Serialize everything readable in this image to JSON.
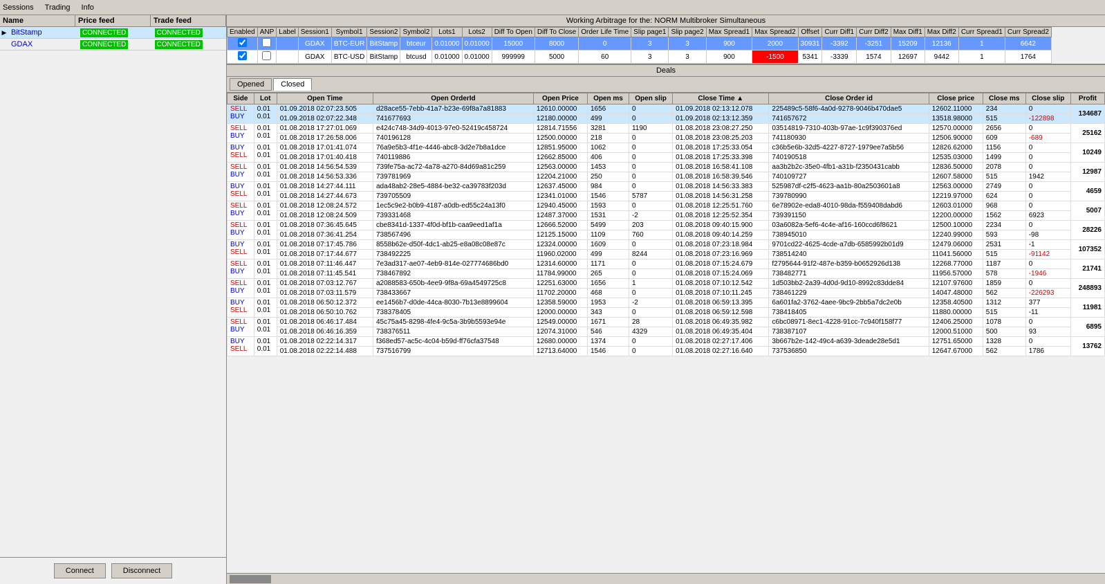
{
  "nav": {
    "items": [
      "Sessions",
      "Trading",
      "Info"
    ]
  },
  "title_bar": "Working Arbitrage for the: NORM Multibroker Simultaneous",
  "left_panel": {
    "headers": [
      "Name",
      "Price feed",
      "Trade feed"
    ],
    "rows": [
      {
        "name": "BitStamp",
        "price": "CONNECTED",
        "trade": "CONNECTED",
        "active": true
      },
      {
        "name": "GDAX",
        "price": "CONNECTED",
        "trade": "CONNECTED",
        "active": false
      }
    ]
  },
  "buttons": {
    "connect": "Connect",
    "disconnect": "Disconnect"
  },
  "top_grid": {
    "headers": [
      "Enabled",
      "ANP",
      "Label",
      "Session1",
      "Symbol1",
      "Session2",
      "Symbol2",
      "Lots1",
      "Lots2",
      "Diff To Open",
      "Diff To Close",
      "Order Life Time",
      "Slip page1",
      "Slip page2",
      "Max Spread1",
      "Max Spread2",
      "Offset",
      "Curr Diff1",
      "Curr Diff2",
      "Max Diff1",
      "Max Diff2",
      "Curr Spread1",
      "Curr Spread2"
    ],
    "rows": [
      {
        "enabled": true,
        "anp": false,
        "label": "",
        "session1": "GDAX",
        "symbol1": "BTC-EUR",
        "session2": "BitStamp",
        "symbol2": "btceur",
        "lots1": "0.01000",
        "lots2": "0.01000",
        "diff_open": "15000",
        "diff_close": "8000",
        "order_life": "0",
        "slip1": "3",
        "slip2": "3",
        "max_spread1": "900",
        "max_spread2": "2000",
        "offset": "30931",
        "curr_diff1": "-3392",
        "curr_diff2": "-3251",
        "max_diff1": "15209",
        "max_diff2": "12136",
        "curr_spread1": "1",
        "curr_spread2": "6642",
        "style": "blue"
      },
      {
        "enabled": true,
        "anp": false,
        "label": "",
        "session1": "GDAX",
        "symbol1": "BTC-USD",
        "session2": "BitStamp",
        "symbol2": "btcusd",
        "lots1": "0.01000",
        "lots2": "0.01000",
        "diff_open": "999999",
        "diff_close": "5000",
        "order_life": "60",
        "slip1": "3",
        "slip2": "3",
        "max_spread1": "900",
        "max_spread2": "-1500",
        "offset": "5341",
        "curr_diff1": "-3339",
        "curr_diff2": "1574",
        "max_diff1": "12697",
        "max_diff2": "9442",
        "curr_spread1": "1",
        "curr_spread2": "1764",
        "style": "white",
        "red_cell": "max_spread2"
      }
    ]
  },
  "deals": {
    "title": "Deals",
    "tabs": [
      "Opened",
      "Closed"
    ],
    "active_tab": "Closed",
    "headers": [
      "Side",
      "Lot",
      "Open Time",
      "Open OrderId",
      "Open Price",
      "Open ms",
      "Open slip",
      "Close Time",
      "Close Order id",
      "Close price",
      "Close ms",
      "Close slip",
      "Profit"
    ],
    "rows": [
      {
        "side": [
          "SELL",
          "BUY"
        ],
        "lot": [
          "0.01",
          "0.01"
        ],
        "open_time": [
          "01.09.2018 02:07:23.505",
          "01.09.2018 02:07:22.348"
        ],
        "open_order": [
          "d28ace55-7ebb-41a7-b23e-69f8a7a81883",
          "741677693"
        ],
        "open_price": [
          "12610.00000",
          "12180.00000"
        ],
        "open_ms": [
          "1656",
          "499"
        ],
        "open_slip": [
          "0",
          "0"
        ],
        "close_time": [
          "01.09.2018 02:13:12.078",
          "01.09.2018 02:13:12.359"
        ],
        "close_order": [
          "225489c5-58f6-4a0d-9278-9046b470dae5",
          "741657672"
        ],
        "close_price": [
          "12602.11000",
          "13518.98000"
        ],
        "close_ms": [
          "234",
          "515"
        ],
        "close_slip": [
          "0",
          "-122898"
        ],
        "profit": "134687",
        "highlighted": true
      },
      {
        "side": [
          "SELL",
          "BUY"
        ],
        "lot": [
          "0.01",
          "0.01"
        ],
        "open_time": [
          "01.08.2018 17:27:01.069",
          "01.08.2018 17:26:58.006"
        ],
        "open_order": [
          "e424c748-34d9-4013-97e0-52419c458724",
          "740196128"
        ],
        "open_price": [
          "12814.71556",
          "12500.00000"
        ],
        "open_ms": [
          "3281",
          "218"
        ],
        "open_slip": [
          "1190",
          "0"
        ],
        "close_time": [
          "01.08.2018 23:08:27.250",
          "01.08.2018 23:08:25.203"
        ],
        "close_order": [
          "03514819-7310-403b-97ae-1c9f390376ed",
          "741180930"
        ],
        "close_price": [
          "12570.00000",
          "12506.90000"
        ],
        "close_ms": [
          "2656",
          "609"
        ],
        "close_slip": [
          "0",
          "-689"
        ],
        "profit": "25162",
        "highlighted": false
      },
      {
        "side": [
          "BUY",
          "SELL"
        ],
        "lot": [
          "0.01",
          "0.01"
        ],
        "open_time": [
          "01.08.2018 17:01:41.074",
          "01.08.2018 17:01:40.418"
        ],
        "open_order": [
          "76a9e5b3-4f1e-4446-abc8-3d2e7b8a1dce",
          "740119886"
        ],
        "open_price": [
          "12851.95000",
          "12662.85000"
        ],
        "open_ms": [
          "1062",
          "406"
        ],
        "open_slip": [
          "0",
          "0"
        ],
        "close_time": [
          "01.08.2018 17:25:33.054",
          "01.08.2018 17:25:33.398"
        ],
        "close_order": [
          "c36b5e6b-32d5-4227-8727-1979ee7a5b56",
          "740190518"
        ],
        "close_price": [
          "12826.62000",
          "12535.03000"
        ],
        "close_ms": [
          "1156",
          "1499"
        ],
        "close_slip": [
          "0",
          "0"
        ],
        "profit": "10249",
        "highlighted": false
      },
      {
        "side": [
          "SELL",
          "BUY"
        ],
        "lot": [
          "0.01",
          "0.01"
        ],
        "open_time": [
          "01.08.2018 14:56:54.539",
          "01.08.2018 14:56:53.336"
        ],
        "open_order": [
          "739fe75a-ac72-4a78-a270-84d69a81c259",
          "739781969"
        ],
        "open_price": [
          "12563.00000",
          "12204.21000"
        ],
        "open_ms": [
          "1453",
          "250"
        ],
        "open_slip": [
          "0",
          "0"
        ],
        "close_time": [
          "01.08.2018 16:58:41.108",
          "01.08.2018 16:58:39.546"
        ],
        "close_order": [
          "aa3b2b2c-35e0-4fb1-a31b-f2350431cabb",
          "740109727"
        ],
        "close_price": [
          "12836.50000",
          "12607.58000"
        ],
        "close_ms": [
          "2078",
          "515"
        ],
        "close_slip": [
          "0",
          "1942"
        ],
        "profit": "12987",
        "highlighted": false
      },
      {
        "side": [
          "BUY",
          "SELL"
        ],
        "lot": [
          "0.01",
          "0.01"
        ],
        "open_time": [
          "01.08.2018 14:27:44.111",
          "01.08.2018 14:27:44.673"
        ],
        "open_order": [
          "ada48ab2-28e5-4884-be32-ca39783f203d",
          "739705509"
        ],
        "open_price": [
          "12637.45000",
          "12341.01000"
        ],
        "open_ms": [
          "984",
          "1546"
        ],
        "open_slip": [
          "0",
          "5787"
        ],
        "close_time": [
          "01.08.2018 14:56:33.383",
          "01.08.2018 14:56:31.258"
        ],
        "close_order": [
          "525987df-c2f5-4623-aa1b-80a2503601a8",
          "739780990"
        ],
        "close_price": [
          "12563.00000",
          "12219.97000"
        ],
        "close_ms": [
          "2749",
          "624"
        ],
        "close_slip": [
          "0",
          "0"
        ],
        "profit": "4659",
        "highlighted": false
      },
      {
        "side": [
          "SELL",
          "BUY"
        ],
        "lot": [
          "0.01",
          "0.01"
        ],
        "open_time": [
          "01.08.2018 12:08:24.572",
          "01.08.2018 12:08:24.509"
        ],
        "open_order": [
          "1ec5c9e2-b0b9-4187-a0db-ed55c24a13f0",
          "739331468"
        ],
        "open_price": [
          "12940.45000",
          "12487.37000"
        ],
        "open_ms": [
          "1593",
          "1531"
        ],
        "open_slip": [
          "0",
          "-2"
        ],
        "close_time": [
          "01.08.2018 12:25:51.760",
          "01.08.2018 12:25:52.354"
        ],
        "close_order": [
          "6e78902e-eda8-4010-98da-f559408dabd6",
          "739391150"
        ],
        "close_price": [
          "12603.01000",
          "12200.00000"
        ],
        "close_ms": [
          "968",
          "1562"
        ],
        "close_slip": [
          "0",
          "6923"
        ],
        "profit": "5007",
        "highlighted": false
      },
      {
        "side": [
          "SELL",
          "BUY"
        ],
        "lot": [
          "0.01",
          "0.01"
        ],
        "open_time": [
          "01.08.2018 07:36:45.645",
          "01.08.2018 07:36:41.254"
        ],
        "open_order": [
          "cbe8341d-1337-4f0d-bf1b-caa9eed1af1a",
          "738567496"
        ],
        "open_price": [
          "12666.52000",
          "12125.15000"
        ],
        "open_ms": [
          "5499",
          "1109"
        ],
        "open_slip": [
          "203",
          "760"
        ],
        "close_time": [
          "01.08.2018 09:40:15.900",
          "01.08.2018 09:40:14.259"
        ],
        "close_order": [
          "03a6082a-5ef6-4c4e-af16-160ccd6f8621",
          "738945010"
        ],
        "close_price": [
          "12500.10000",
          "12240.99000"
        ],
        "close_ms": [
          "2234",
          "593"
        ],
        "close_slip": [
          "0",
          "-98"
        ],
        "profit": "28226",
        "highlighted": false
      },
      {
        "side": [
          "BUY",
          "SELL"
        ],
        "lot": [
          "0.01",
          "0.01"
        ],
        "open_time": [
          "01.08.2018 07:17:45.786",
          "01.08.2018 07:17:44.677"
        ],
        "open_order": [
          "8558b62e-d50f-4dc1-ab25-e8a08c08e87c",
          "738492225"
        ],
        "open_price": [
          "12324.00000",
          "11960.02000"
        ],
        "open_ms": [
          "1609",
          "499"
        ],
        "open_slip": [
          "0",
          "8244"
        ],
        "close_time": [
          "01.08.2018 07:23:18.984",
          "01.08.2018 07:23:16.969"
        ],
        "close_order": [
          "9701cd22-4625-4cde-a7db-6585992b01d9",
          "738514240"
        ],
        "close_price": [
          "12479.06000",
          "11041.56000"
        ],
        "close_ms": [
          "2531",
          "515"
        ],
        "close_slip": [
          "-1",
          "-91142"
        ],
        "profit": "107352",
        "highlighted": false
      },
      {
        "side": [
          "SELL",
          "BUY"
        ],
        "lot": [
          "0.01",
          "0.01"
        ],
        "open_time": [
          "01.08.2018 07:11:46.447",
          "01.08.2018 07:11:45.541"
        ],
        "open_order": [
          "7e3ad317-ae07-4eb9-814e-027774686bd0",
          "738467892"
        ],
        "open_price": [
          "12314.60000",
          "11784.99000"
        ],
        "open_ms": [
          "1171",
          "265"
        ],
        "open_slip": [
          "0",
          "0"
        ],
        "close_time": [
          "01.08.2018 07:15:24.679",
          "01.08.2018 07:15:24.069"
        ],
        "close_order": [
          "f2795644-91f2-487e-b359-b0652926d138",
          "738482771"
        ],
        "close_price": [
          "12268.77000",
          "11956.57000"
        ],
        "close_ms": [
          "1187",
          "578"
        ],
        "close_slip": [
          "0",
          "-1946"
        ],
        "profit": "21741",
        "highlighted": false
      },
      {
        "side": [
          "SELL",
          "BUY"
        ],
        "lot": [
          "0.01",
          "0.01"
        ],
        "open_time": [
          "01.08.2018 07:03:12.767",
          "01.08.2018 07:03:11.579"
        ],
        "open_order": [
          "a2088583-650b-4ee9-9f8a-69a4549725c8",
          "738433667"
        ],
        "open_price": [
          "12251.63000",
          "11702.20000"
        ],
        "open_ms": [
          "1656",
          "468"
        ],
        "open_slip": [
          "1",
          "0"
        ],
        "close_time": [
          "01.08.2018 07:10:12.542",
          "01.08.2018 07:10:11.245"
        ],
        "close_order": [
          "1d503bb2-2a39-4d0d-9d10-8992c83dde84",
          "738461229"
        ],
        "close_price": [
          "12107.97600",
          "14047.48000"
        ],
        "close_ms": [
          "1859",
          "562"
        ],
        "close_slip": [
          "0",
          "-226293"
        ],
        "profit": "248893",
        "highlighted": false
      },
      {
        "side": [
          "BUY",
          "SELL"
        ],
        "lot": [
          "0.01",
          "0.01"
        ],
        "open_time": [
          "01.08.2018 06:50:12.372",
          "01.08.2018 06:50:10.762"
        ],
        "open_order": [
          "ee1456b7-d0de-44ca-8030-7b13e8899604",
          "738378405"
        ],
        "open_price": [
          "12358.59000",
          "12000.00000"
        ],
        "open_ms": [
          "1953",
          "343"
        ],
        "open_slip": [
          "-2",
          "0"
        ],
        "close_time": [
          "01.08.2018 06:59:13.395",
          "01.08.2018 06:59:12.598"
        ],
        "close_order": [
          "6a601fa2-3762-4aee-9bc9-2bb5a7dc2e0b",
          "738418405"
        ],
        "close_price": [
          "12358.40500",
          "11880.00000"
        ],
        "close_ms": [
          "1312",
          "515"
        ],
        "close_slip": [
          "377",
          "-11"
        ],
        "profit": "11981",
        "highlighted": false
      },
      {
        "side": [
          "SELL",
          "BUY"
        ],
        "lot": [
          "0.01",
          "0.01"
        ],
        "open_time": [
          "01.08.2018 06:46:17.484",
          "01.08.2018 06:46:16.359"
        ],
        "open_order": [
          "45c75a45-8298-4fe4-9c5a-3b9b5593e94e",
          "738376511"
        ],
        "open_price": [
          "12549.00000",
          "12074.31000"
        ],
        "open_ms": [
          "1671",
          "546"
        ],
        "open_slip": [
          "28",
          "4329"
        ],
        "close_time": [
          "01.08.2018 06:49:35.982",
          "01.08.2018 06:49:35.404"
        ],
        "close_order": [
          "c6bc08971-8ec1-4228-91cc-7c940f158f77",
          "738387107"
        ],
        "close_price": [
          "12406.25000",
          "12000.51000"
        ],
        "close_ms": [
          "1078",
          "500"
        ],
        "close_slip": [
          "0",
          "93"
        ],
        "profit": "6895",
        "highlighted": false
      },
      {
        "side": [
          "BUY",
          "SELL"
        ],
        "lot": [
          "0.01",
          "0.01"
        ],
        "open_time": [
          "01.08.2018 02:22:14.317",
          "01.08.2018 02:22:14.488"
        ],
        "open_order": [
          "f368ed57-ac5c-4c04-b59d-ff76cfa37548",
          "737516799"
        ],
        "open_price": [
          "12680.00000",
          "12713.64000"
        ],
        "open_ms": [
          "1374",
          "1546"
        ],
        "open_slip": [
          "0",
          "0"
        ],
        "close_time": [
          "01.08.2018 02:27:17.406",
          "01.08.2018 02:27:16.640"
        ],
        "close_order": [
          "3b667b2e-142-49c4-a639-3deade28e5d1",
          "737536850"
        ],
        "close_price": [
          "12751.65000",
          "12647.67000"
        ],
        "close_ms": [
          "1328",
          "562"
        ],
        "close_slip": [
          "0",
          "1786"
        ],
        "profit": "13762",
        "highlighted": false
      }
    ]
  }
}
